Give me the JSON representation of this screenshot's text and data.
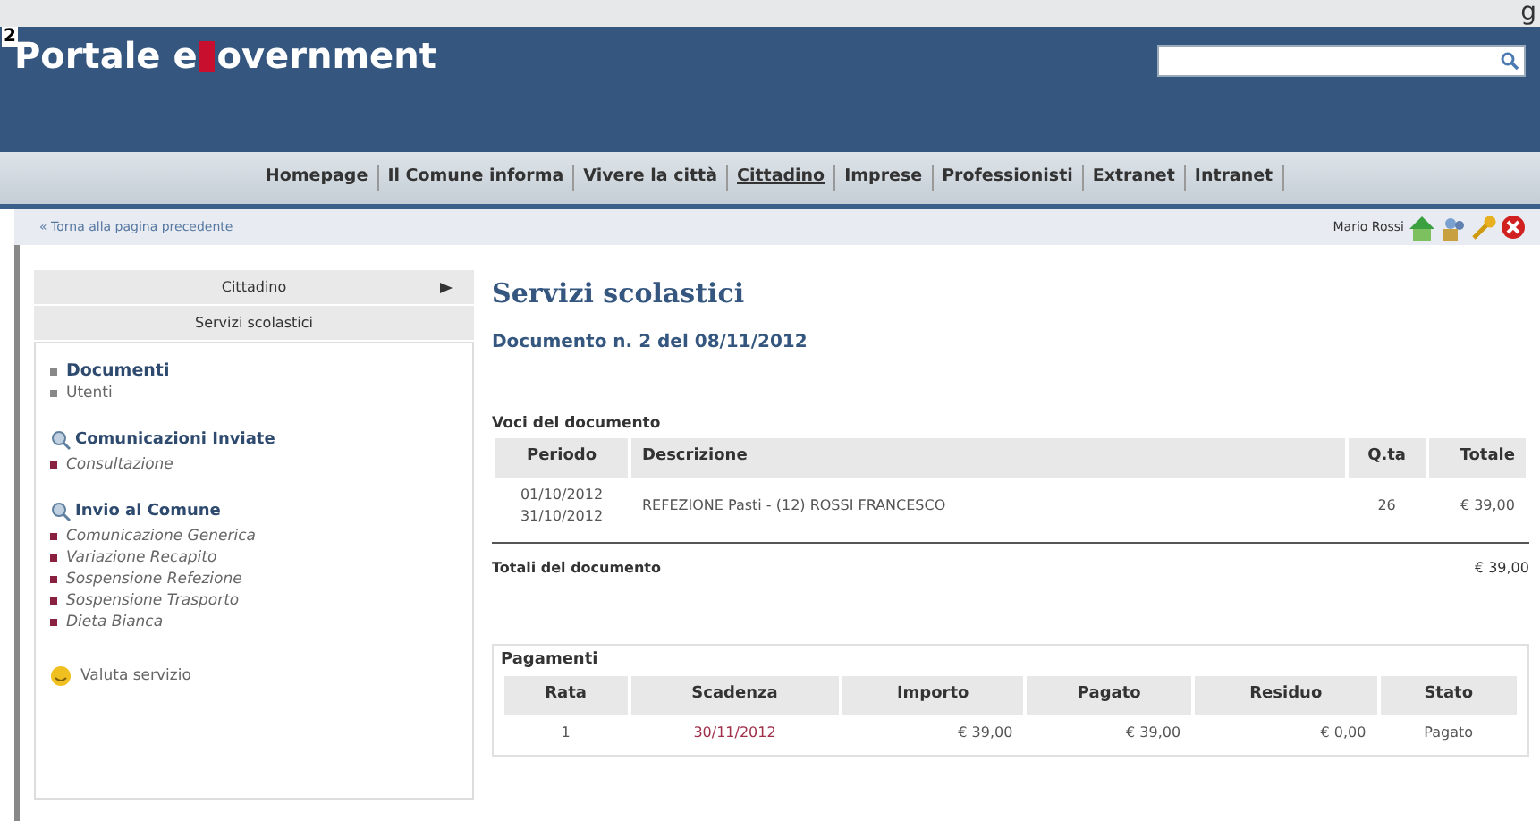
{
  "corner_text": "g",
  "page_badge": "2",
  "header": {
    "title_start": "Portale e",
    "title_end": "overnment"
  },
  "nav": [
    {
      "label": "Homepage",
      "selected": false
    },
    {
      "label": "Il Comune informa",
      "selected": false
    },
    {
      "label": "Vivere la città",
      "selected": false
    },
    {
      "label": "Cittadino",
      "selected": true
    },
    {
      "label": "Imprese",
      "selected": false
    },
    {
      "label": "Professionisti",
      "selected": false
    },
    {
      "label": "Extranet",
      "selected": false
    },
    {
      "label": "Intranet",
      "selected": false
    }
  ],
  "back_link": "« Torna alla pagina precedente",
  "user": "Mario Rossi",
  "sidebar": {
    "section": "Cittadino",
    "subsection": "Servizi scolastici",
    "groups": [
      {
        "kind": "plain",
        "items": [
          {
            "label": "Documenti",
            "selected": true
          },
          {
            "label": "Utenti",
            "selected": false
          }
        ]
      },
      {
        "kind": "titled",
        "title": "Comunicazioni Inviate",
        "items": [
          {
            "label": "Consultazione",
            "selected": false
          }
        ]
      },
      {
        "kind": "titled",
        "title": "Invio al Comune",
        "items": [
          {
            "label": "Comunicazione Generica",
            "selected": false
          },
          {
            "label": "Variazione Recapito",
            "selected": false
          },
          {
            "label": "Sospensione Refezione",
            "selected": false
          },
          {
            "label": "Sospensione Trasporto",
            "selected": false
          },
          {
            "label": "Dieta Bianca",
            "selected": false
          }
        ]
      }
    ],
    "rate_link": "Valuta servizio"
  },
  "main": {
    "title": "Servizi scolastici",
    "subtitle": "Documento n. 2 del 08/11/2012",
    "items_caption": "Voci del documento",
    "items_columns": [
      "Periodo",
      "Descrizione",
      "Q.ta",
      "Totale"
    ],
    "items_rows": [
      {
        "period_start": "01/10/2012",
        "period_end": "31/10/2012",
        "description": "REFEZIONE Pasti - (12) ROSSI FRANCESCO",
        "qty": "26",
        "total": "€ 39,00"
      }
    ],
    "totals_label": "Totali del documento",
    "totals_value": "€ 39,00",
    "payments_caption": "Pagamenti",
    "payments_columns": [
      "Rata",
      "Scadenza",
      "Importo",
      "Pagato",
      "Residuo",
      "Stato"
    ],
    "payments_rows": [
      [
        "1",
        "30/11/2012",
        "€ 39,00",
        "€ 39,00",
        "€ 0,00",
        "Pagato"
      ]
    ]
  }
}
